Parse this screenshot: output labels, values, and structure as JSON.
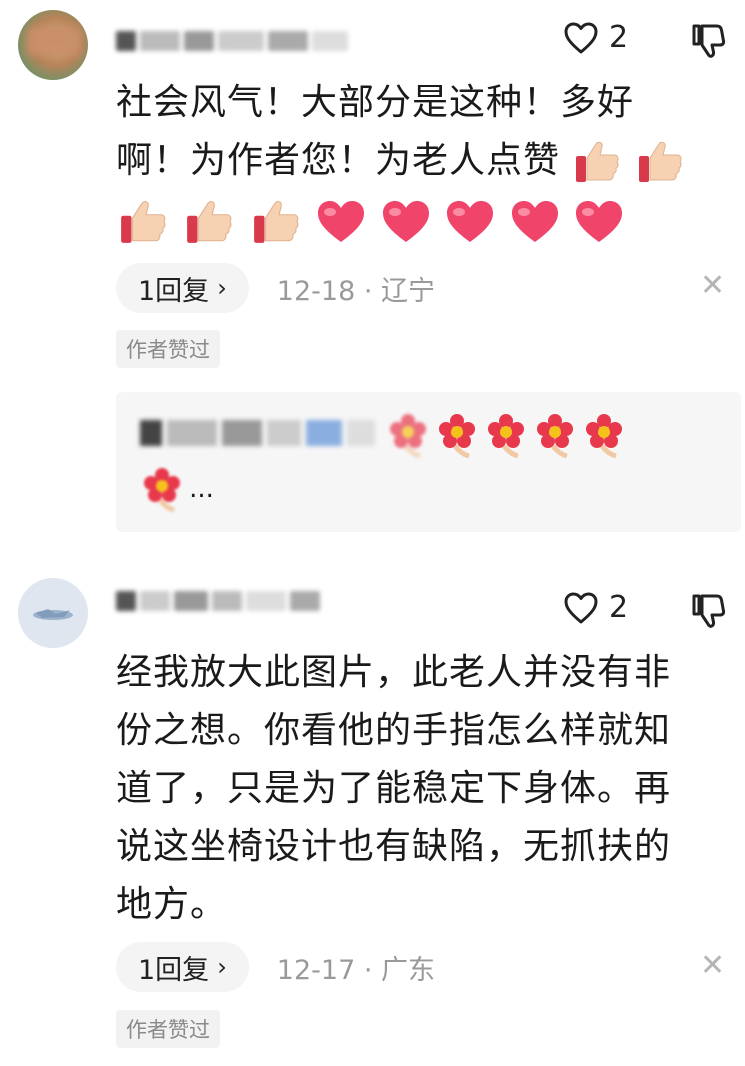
{
  "comments": [
    {
      "likes": "2",
      "text_line1": "社会风气！大部分是这种！多好",
      "text_line2": "啊！为作者您！为老人点赞",
      "reply_label": "1回复",
      "date_location": "12-18 · 辽宁",
      "author_tag": "作者赞过",
      "emoji_line1_thumbs": 2,
      "emoji_line2_thumbs": 3,
      "emoji_line2_hearts": 5
    },
    {
      "likes": "2",
      "text_line1": "经我放大此图片，此老人并没有非",
      "text_line2": "份之想。你看他的手指怎么样就知",
      "text_line3": "道了，只是为了能稳定下身体。再",
      "text_line4": "说这坐椅设计也有缺陷，无抓扶的",
      "text_line5": "地方。",
      "reply_label": "1回复",
      "date_location": "12-17 · 广东",
      "author_tag": "作者赞过"
    }
  ],
  "nested_reply": {
    "ellipsis": "..."
  },
  "colors": {
    "heart": "#f0446b",
    "meta": "#9a9a9a",
    "bg_reply": "#f6f6f6"
  },
  "icons": [
    "heart-outline-icon",
    "thumbs-down-icon",
    "close-icon",
    "chevron-right-icon",
    "thumbs-up-emoji",
    "heart-emoji",
    "flower-emoji"
  ]
}
